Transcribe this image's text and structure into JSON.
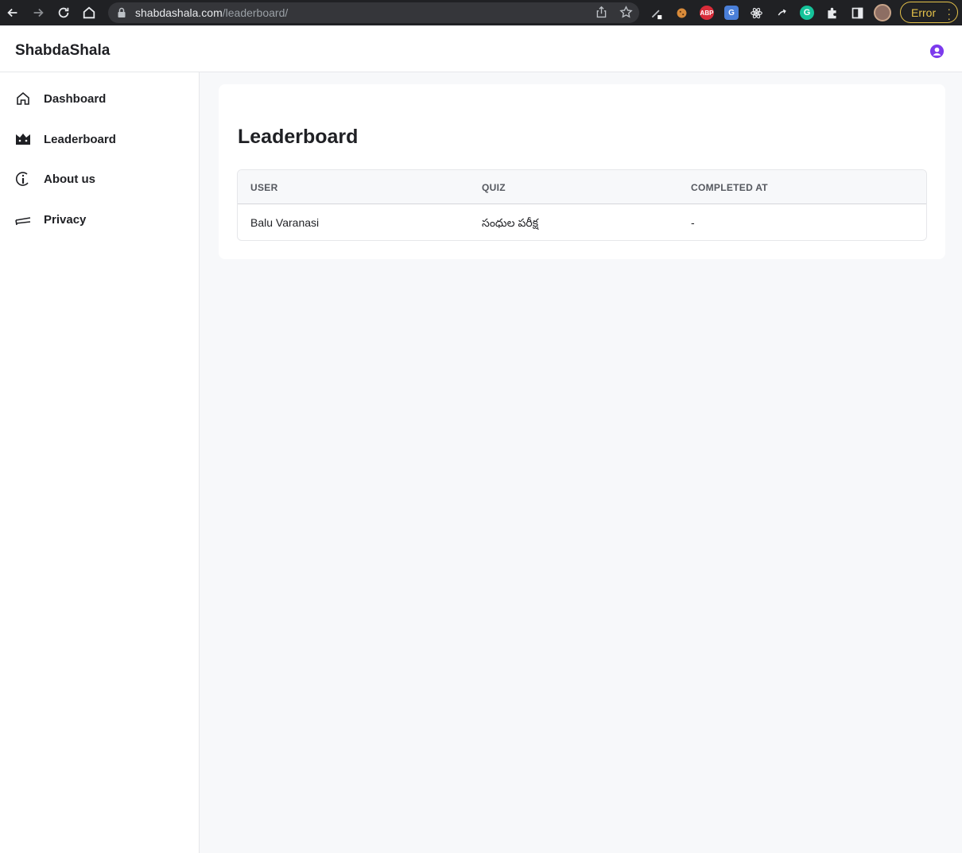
{
  "browser": {
    "url_host": "shabdashala.com",
    "url_path": "/leaderboard/",
    "error_label": "Error",
    "extensions": [
      "pen-icon",
      "cookie-icon",
      "abp-icon",
      "translate-icon",
      "react-icon",
      "arrow-icon",
      "grammarly-icon",
      "puzzle-icon",
      "sidepanel-icon"
    ],
    "ext_abp_label": "ABP",
    "ext_translate_label": "G",
    "ext_grammarly_label": "G"
  },
  "header": {
    "brand": "ShabdaShala"
  },
  "sidebar": {
    "items": [
      {
        "label": "Dashboard",
        "icon": "home-icon"
      },
      {
        "label": "Leaderboard",
        "icon": "crown-icon"
      },
      {
        "label": "About us",
        "icon": "info-icon"
      },
      {
        "label": "Privacy",
        "icon": "privacy-icon"
      }
    ]
  },
  "main": {
    "title": "Leaderboard",
    "table": {
      "columns": [
        "USER",
        "QUIZ",
        "COMPLETED AT"
      ],
      "rows": [
        [
          "Balu Varanasi",
          "సంధుల పరీక్ష",
          "-"
        ]
      ]
    }
  },
  "colors": {
    "accent": "#7c3aed",
    "page_bg": "#f7f8fa",
    "error_chip": "#e6c34a"
  }
}
